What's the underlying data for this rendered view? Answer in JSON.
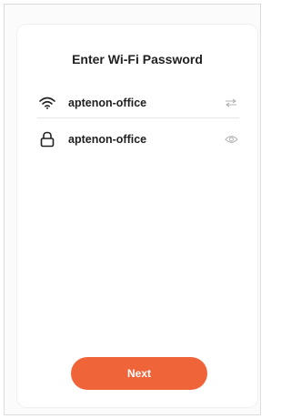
{
  "page": {
    "title": "Enter Wi-Fi Password"
  },
  "wifi": {
    "ssid": "aptenon-office",
    "ssid_icon": "wifi-icon",
    "switch_icon": "switch-network-icon"
  },
  "password": {
    "value": "aptenon-office",
    "lock_icon": "lock-icon",
    "toggle_icon": "eye-icon"
  },
  "actions": {
    "next_label": "Next"
  },
  "colors": {
    "accent": "#f0643a",
    "text": "#222222",
    "icon_muted": "#b5b5b5"
  }
}
